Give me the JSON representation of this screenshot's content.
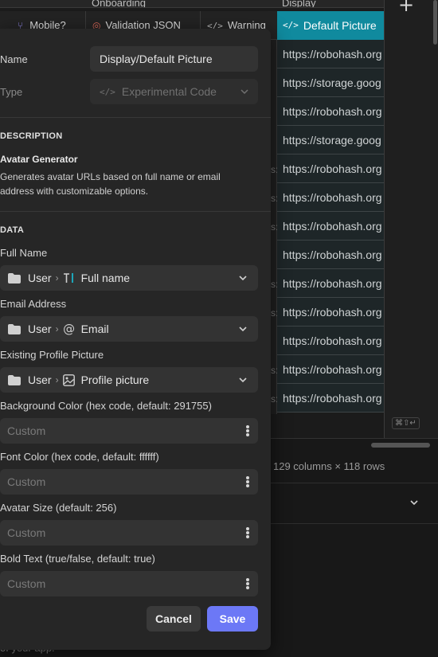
{
  "grid": {
    "group_headers": [
      "Onboarding",
      "Display"
    ],
    "columns": [
      "Mobile?",
      "Validation JSON",
      "Warning"
    ],
    "display_column_header": "Default Picture",
    "display_values": [
      "https://robohash.org",
      "https://storage.goog",
      "https://robohash.org",
      "https://storage.goog",
      "https://robohash.org",
      "https://robohash.org",
      "https://robohash.org",
      "https://robohash.org",
      "https://robohash.org",
      "https://robohash.org",
      "https://robohash.org",
      "https://robohash.org",
      "https://robohash.org"
    ],
    "row_count_text": "129 columns × 118 rows",
    "keyboard_hint": "⌘⇧↵",
    "add_column_icon": "plus-icon",
    "footer_fragment": "of your app."
  },
  "panel": {
    "name_label": "Name",
    "name_value": "Display/Default Picture",
    "type_label": "Type",
    "type_value": "Experimental Code",
    "description_section": "DESCRIPTION",
    "component_title": "Avatar Generator",
    "component_description": "Generates avatar URLs based on full name or email address with customizable options.",
    "data_section": "DATA",
    "mappings": [
      {
        "label": "Full Name",
        "source": "User",
        "field": "Full name",
        "icon": "text-icon"
      },
      {
        "label": "Email Address",
        "source": "User",
        "field": "Email",
        "icon": "at-sign-icon"
      },
      {
        "label": "Existing Profile Picture",
        "source": "User",
        "field": "Profile picture",
        "icon": "image-icon"
      }
    ],
    "options": [
      {
        "label": "Background Color (hex code, default: 291755)",
        "placeholder": "Custom"
      },
      {
        "label": "Font Color (hex code, default: ffffff)",
        "placeholder": "Custom"
      },
      {
        "label": "Avatar Size (default: 256)",
        "placeholder": "Custom"
      },
      {
        "label": "Bold Text (true/false, default: true)",
        "placeholder": "Custom"
      }
    ],
    "cancel_label": "Cancel",
    "save_label": "Save"
  },
  "colors": {
    "accent_teal": "#108a9e",
    "save_button": "#6c78f6",
    "panel_bg": "#262626",
    "field_bg": "#333333"
  }
}
